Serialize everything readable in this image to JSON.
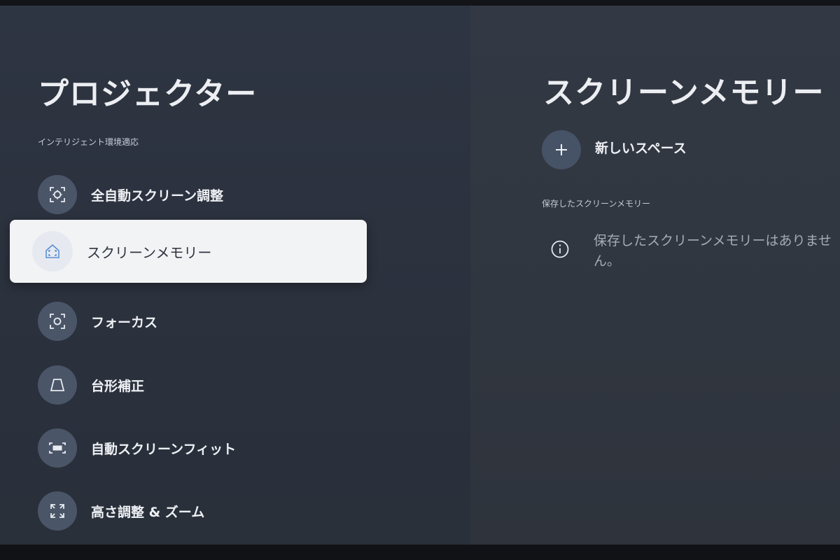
{
  "left": {
    "title": "プロジェクター",
    "section_label": "インテリジェント環境適応",
    "items": [
      {
        "label": "全自動スクリーン調整",
        "icon": "auto-screen-adjust-icon"
      },
      {
        "label": "スクリーンメモリー",
        "icon": "screen-memory-home-icon",
        "selected": true
      },
      {
        "label": "フォーカス",
        "icon": "focus-icon"
      },
      {
        "label": "台形補正",
        "icon": "keystone-icon"
      },
      {
        "label": "自動スクリーンフィット",
        "icon": "screen-fit-icon"
      },
      {
        "label": "高さ調整 & ズーム",
        "icon": "zoom-expand-icon"
      }
    ]
  },
  "right": {
    "title": "スクリーンメモリー",
    "new_space_label": "新しいスペース",
    "saved_section_label": "保存したスクリーンメモリー",
    "empty_message": "保存したスクリーンメモリーはありません。"
  },
  "colors": {
    "background": "#2e3542",
    "icon_circle": "#4a5568",
    "selected_bg": "#f2f3f5",
    "accent_icon": "#5b8fd6"
  }
}
